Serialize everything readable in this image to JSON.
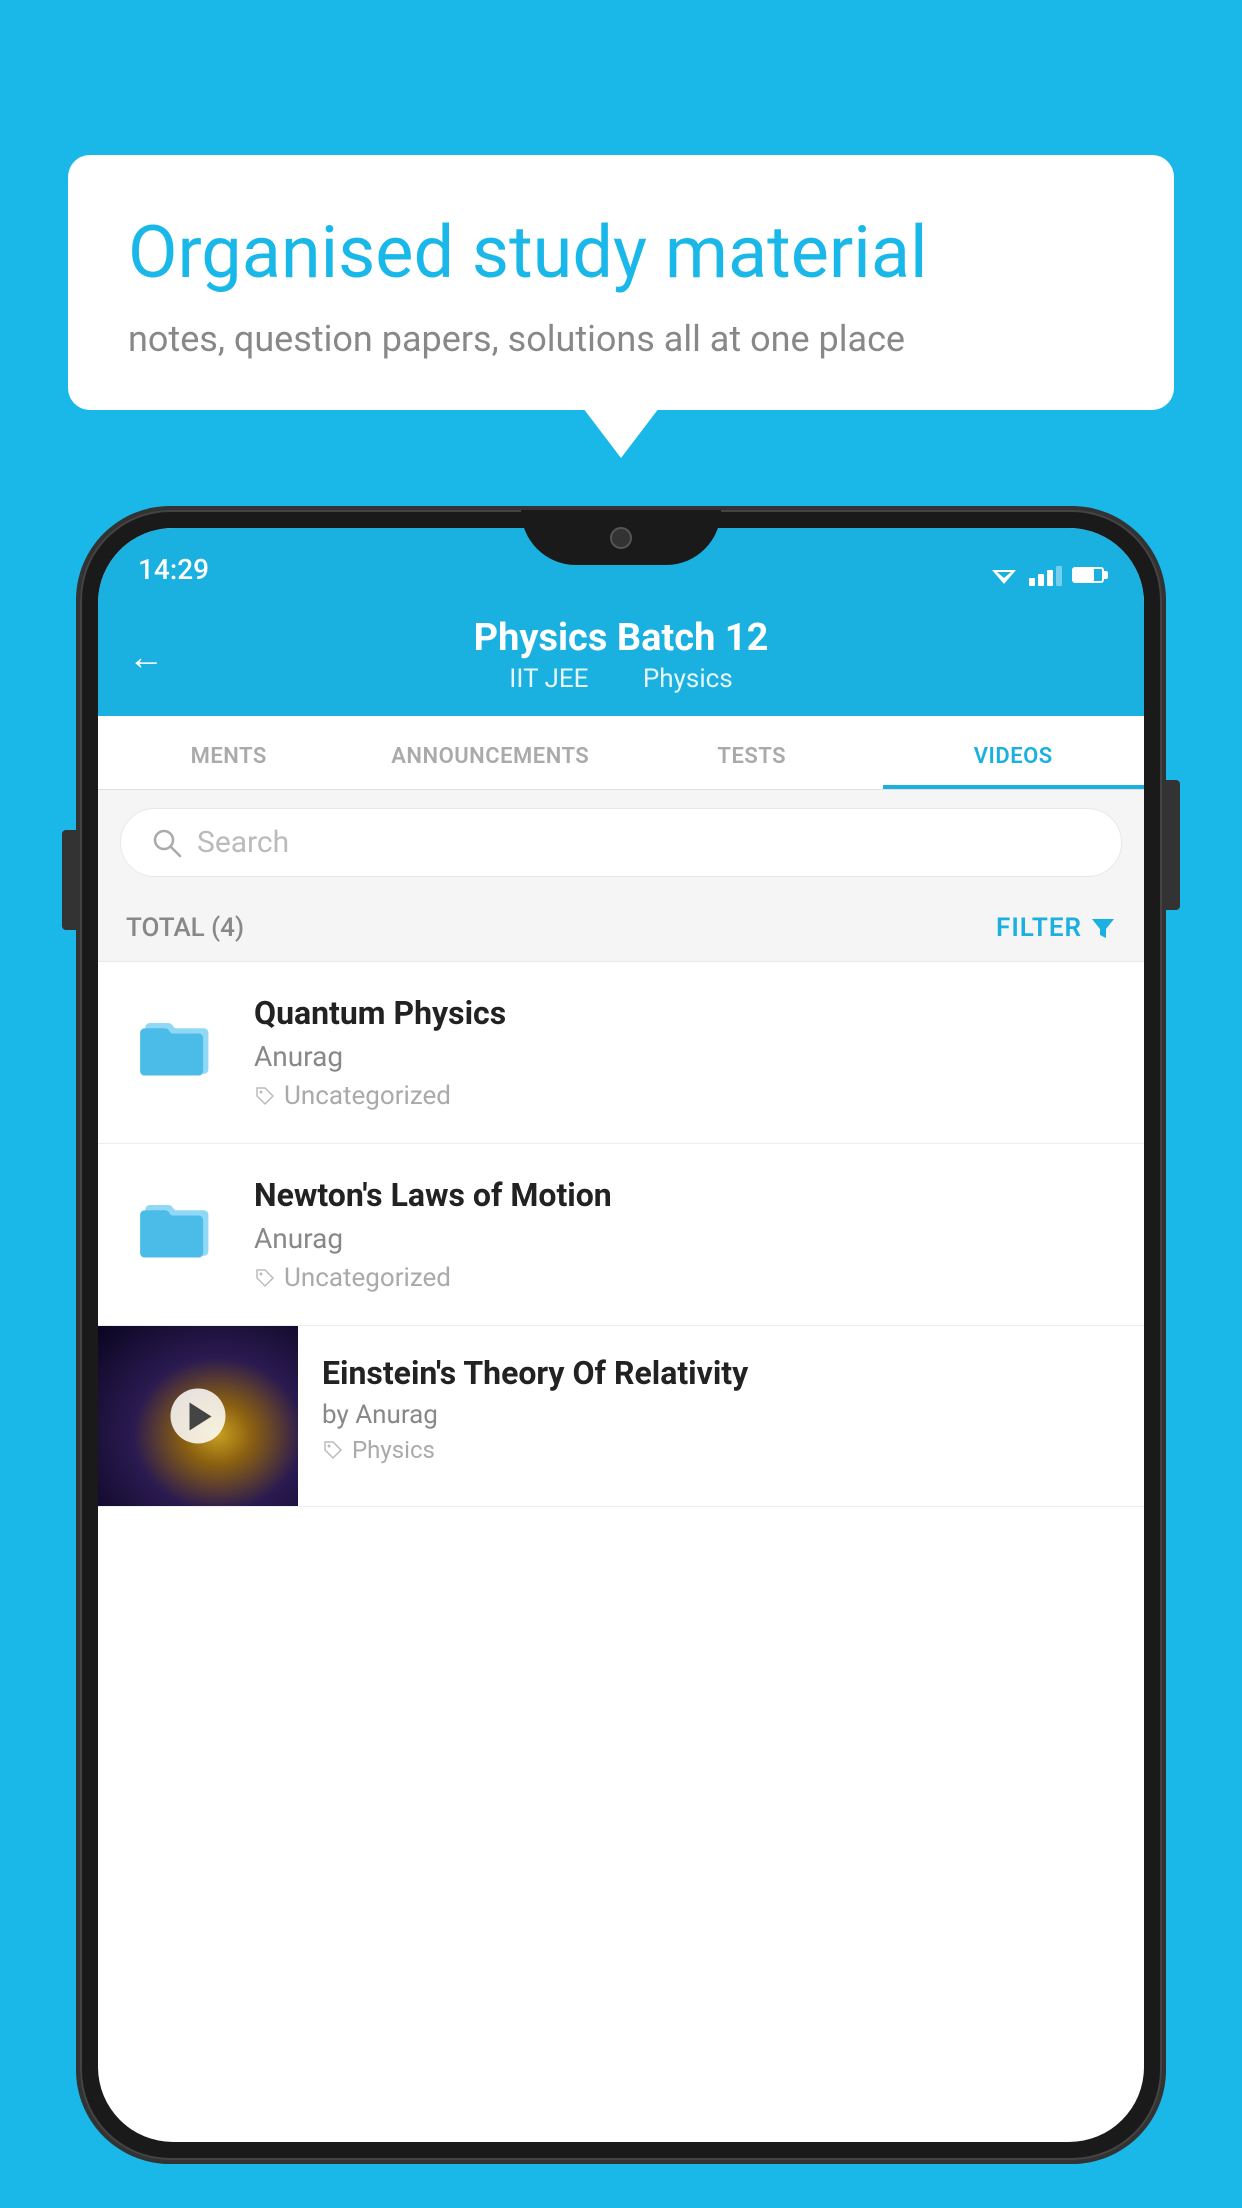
{
  "app": {
    "background_color": "#1ab8e8"
  },
  "speech_bubble": {
    "title": "Organised study material",
    "subtitle": "notes, question papers, solutions all at one place"
  },
  "status_bar": {
    "time": "14:29"
  },
  "header": {
    "title": "Physics Batch 12",
    "subtitle_left": "IIT JEE",
    "subtitle_right": "Physics",
    "back_label": "←"
  },
  "tabs": [
    {
      "label": "MENTS",
      "active": false
    },
    {
      "label": "ANNOUNCEMENTS",
      "active": false
    },
    {
      "label": "TESTS",
      "active": false
    },
    {
      "label": "VIDEOS",
      "active": true
    }
  ],
  "search": {
    "placeholder": "Search"
  },
  "filter_bar": {
    "total_label": "TOTAL (4)",
    "filter_label": "FILTER"
  },
  "videos": [
    {
      "title": "Quantum Physics",
      "author": "Anurag",
      "tag": "Uncategorized",
      "has_thumb": false
    },
    {
      "title": "Newton's Laws of Motion",
      "author": "Anurag",
      "tag": "Uncategorized",
      "has_thumb": false
    },
    {
      "title": "Einstein's Theory Of Relativity",
      "author": "by Anurag",
      "tag": "Physics",
      "has_thumb": true
    }
  ]
}
